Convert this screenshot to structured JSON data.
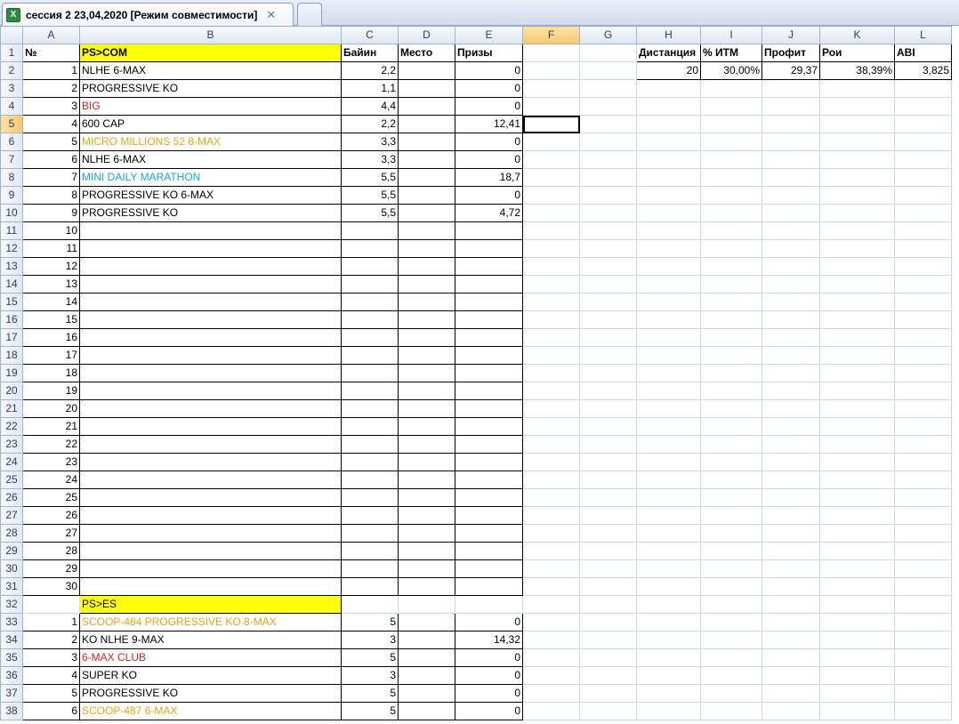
{
  "window": {
    "tab_title": "сессия 2 23,04,2020  [Режим совместимости]",
    "tab_close": "✕",
    "excel_icon_glyph": "X"
  },
  "columns": [
    "A",
    "B",
    "C",
    "D",
    "E",
    "F",
    "G",
    "H",
    "I",
    "J",
    "K",
    "L"
  ],
  "selected_cell": "F5",
  "colors": {
    "highlight": "#ffff00",
    "red": "#e0201a",
    "orange": "#f0a30a",
    "blue": "#13a8e0"
  },
  "rows": [
    {
      "r": "1",
      "A": "№",
      "B": "PS>COM",
      "C": "Байин",
      "D": "Место",
      "E": "Призы",
      "H": "Дистанция",
      "I": "% ИТМ",
      "J": "Профит",
      "K": "Рои",
      "L": "ABI"
    },
    {
      "r": "2",
      "A": "1",
      "B": "NLHE 6-MAX",
      "C": "2,2",
      "D": "",
      "E": "0",
      "H": "20",
      "I": "30,00%",
      "J": "29,37",
      "K": "38,39%",
      "L": "3,825"
    },
    {
      "r": "3",
      "A": "2",
      "B": "PROGRESSIVE KO",
      "C": "1,1",
      "D": "",
      "E": "0"
    },
    {
      "r": "4",
      "A": "3",
      "B": "BIG",
      "C": "4,4",
      "D": "",
      "E": "0",
      "Bcolor": "red"
    },
    {
      "r": "5",
      "A": "4",
      "B": "600 CAP",
      "C": "2,2",
      "D": "",
      "E": "12,41"
    },
    {
      "r": "6",
      "A": "5",
      "B": "MICRO MILLIONS 52 8-MAX",
      "C": "3,3",
      "D": "",
      "E": "0",
      "Bcolor": "orange"
    },
    {
      "r": "7",
      "A": "6",
      "B": "NLHE 6-MAX",
      "C": "3,3",
      "D": "",
      "E": "0"
    },
    {
      "r": "8",
      "A": "7",
      "B": "MINI DAILY MARATHON",
      "C": "5,5",
      "D": "",
      "E": "18,7",
      "Bcolor": "blue"
    },
    {
      "r": "9",
      "A": "8",
      "B": "PROGRESSIVE KO 6-MAX",
      "C": "5,5",
      "D": "",
      "E": "0"
    },
    {
      "r": "10",
      "A": "9",
      "B": "PROGRESSIVE KO",
      "C": "5,5",
      "D": "",
      "E": "4,72"
    },
    {
      "r": "11",
      "A": "10"
    },
    {
      "r": "12",
      "A": "11"
    },
    {
      "r": "13",
      "A": "12"
    },
    {
      "r": "14",
      "A": "13"
    },
    {
      "r": "15",
      "A": "14"
    },
    {
      "r": "16",
      "A": "15"
    },
    {
      "r": "17",
      "A": "16"
    },
    {
      "r": "18",
      "A": "17"
    },
    {
      "r": "19",
      "A": "18"
    },
    {
      "r": "20",
      "A": "19"
    },
    {
      "r": "21",
      "A": "20"
    },
    {
      "r": "22",
      "A": "21"
    },
    {
      "r": "23",
      "A": "22"
    },
    {
      "r": "24",
      "A": "23"
    },
    {
      "r": "25",
      "A": "24"
    },
    {
      "r": "26",
      "A": "25"
    },
    {
      "r": "27",
      "A": "26"
    },
    {
      "r": "28",
      "A": "27"
    },
    {
      "r": "29",
      "A": "28"
    },
    {
      "r": "30",
      "A": "29"
    },
    {
      "r": "31",
      "A": "30"
    },
    {
      "r": "32",
      "A": "",
      "B": "PS>ES"
    },
    {
      "r": "33",
      "A": "1",
      "B": "SCOOP-484 PROGRESSIVE KO 8-MAX",
      "C": "5",
      "D": "",
      "E": "0",
      "Bcolor": "orange"
    },
    {
      "r": "34",
      "A": "2",
      "B": "KO NLHE 9-MAX",
      "C": "3",
      "D": "",
      "E": "14,32"
    },
    {
      "r": "35",
      "A": "3",
      "B": "6-MAX CLUB",
      "C": "5",
      "D": "",
      "E": "0",
      "Bcolor": "red"
    },
    {
      "r": "36",
      "A": "4",
      "B": "SUPER KO",
      "C": "3",
      "D": "",
      "E": "0"
    },
    {
      "r": "37",
      "A": "5",
      "B": "PROGRESSIVE KO",
      "C": "5",
      "D": "",
      "E": "0"
    },
    {
      "r": "38",
      "A": "6",
      "B": "SCOOP-487 6-MAX",
      "C": "5",
      "D": "",
      "E": "0",
      "Bcolor": "orange"
    }
  ]
}
